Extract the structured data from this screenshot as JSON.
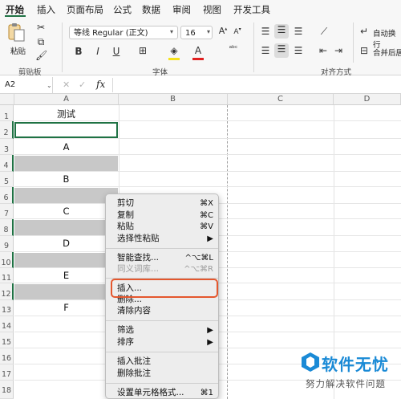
{
  "ribbon_tabs": [
    "开始",
    "插入",
    "页面布局",
    "公式",
    "数据",
    "审阅",
    "视图",
    "开发工具"
  ],
  "ribbon": {
    "paste_label": "粘贴",
    "clipboard_group": "剪贴板",
    "font_name": "等线 Regular (正文)",
    "font_size": "16",
    "font_group": "字体",
    "bold": "B",
    "italic": "I",
    "underline": "U",
    "font_color_letter": "A",
    "align_group": "对齐方式",
    "wrap_text": "自动换行",
    "merge_center": "合并后居中",
    "grow_font": "A",
    "shrink_font": "A"
  },
  "formula_bar": {
    "name_box": "A2",
    "cancel": "✕",
    "confirm": "✓",
    "fx": "fx"
  },
  "columns": [
    "A",
    "B",
    "C",
    "D"
  ],
  "rows": [
    "1",
    "2",
    "3",
    "4",
    "5",
    "6",
    "7",
    "8",
    "9",
    "10",
    "11",
    "12",
    "13",
    "14",
    "15",
    "16",
    "17",
    "18"
  ],
  "cells_A": {
    "r1": "测试",
    "r3": "A",
    "r5": "B",
    "r7": "C",
    "r9": "D",
    "r11": "E",
    "r13": "F"
  },
  "context_menu": {
    "cut": {
      "label": "剪切",
      "shortcut": "⌘X"
    },
    "copy": {
      "label": "复制",
      "shortcut": "⌘C"
    },
    "paste": {
      "label": "粘贴",
      "shortcut": "⌘V"
    },
    "paste_special": {
      "label": "选择性粘贴",
      "shortcut": "▶"
    },
    "smart_lookup": {
      "label": "智能查找...",
      "shortcut": "^⌥⌘L"
    },
    "thesaurus": {
      "label": "同义词库...",
      "shortcut": "^⌥⌘R"
    },
    "insert": {
      "label": "插入..."
    },
    "delete": {
      "label": "删除..."
    },
    "clear": {
      "label": "清除内容"
    },
    "filter": {
      "label": "筛选",
      "shortcut": "▶"
    },
    "sort": {
      "label": "排序",
      "shortcut": "▶"
    },
    "insert_comment": {
      "label": "插入批注"
    },
    "delete_comment": {
      "label": "删除批注"
    },
    "format_cells": {
      "label": "设置单元格格式...",
      "shortcut": "⌘1"
    }
  },
  "watermark": {
    "title": "软件无忧",
    "subtitle": "努力解决软件问题"
  },
  "colors": {
    "excel_green": "#1f7244",
    "highlight_red": "#e4572e",
    "watermark_blue": "#1a8ad6"
  }
}
